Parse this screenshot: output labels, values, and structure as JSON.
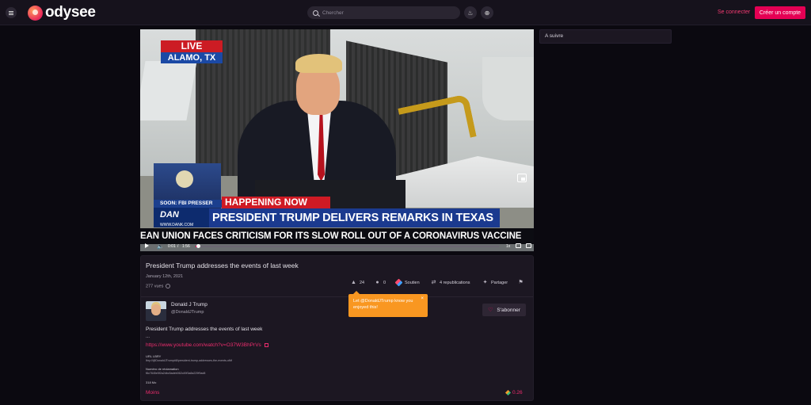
{
  "header": {
    "logo_text": "odysee",
    "search_placeholder": "Chercher",
    "connect_label": "Se connecter",
    "create_account_label": "Créer un compte",
    "notification_icon": "bell-icon",
    "publish_icon": "plus-circle-icon"
  },
  "video": {
    "live_label": "LIVE",
    "location_label": "ALAMO, TX",
    "happening_label": "HAPPENING NOW",
    "soon_label": "SOON: FBI PRESSER",
    "network_logo": "DAN",
    "network_url": "WWW.DANK.COM",
    "headline": "PRESIDENT TRUMP DELIVERS REMARKS IN TEXAS",
    "ticker": "EAN UNION FACES CRITICISM FOR ITS SLOW ROLL OUT OF A CORONAVIRUS VACCINE",
    "time_current": "0:01",
    "time_separator": "/",
    "time_total": "1:56",
    "progress_fraction": 0.009,
    "speed_label": "1x"
  },
  "claim": {
    "title": "President Trump addresses the events of last week",
    "date": "January 12th, 2021",
    "views": "277 vues",
    "likes": "24",
    "dislikes": "0",
    "support_label": "Soutien",
    "reposts_label": "4 republications",
    "share_label": "Partager",
    "tooltip_text": "Let @DonaldJTrump know you enjoyed this!",
    "tooltip_close": "×",
    "channel_name": "Donald J Trump",
    "channel_handle": "@DonaldJTrump",
    "subscribe_label": "S'abonner",
    "description": "President Trump addresses the events of last week",
    "ellipsis": "...",
    "link": "https://www.youtube.com/watch?v=O37W3BhPrVs",
    "lbry_url_label": "URL LBRY",
    "lbry_url": "lbry://@DonaldJTrump#8/president-trump-addresses-the-events-of#f",
    "claim_id_label": "Numéro de réclamation",
    "claim_id": "f8c7845e5f2a2dbc5adeb062c49f3a8a229f9ad8",
    "size": "318 Mo",
    "less_label": "Moins",
    "amount": "0.26"
  },
  "sidebar": {
    "up_next_label": "A suivre"
  }
}
